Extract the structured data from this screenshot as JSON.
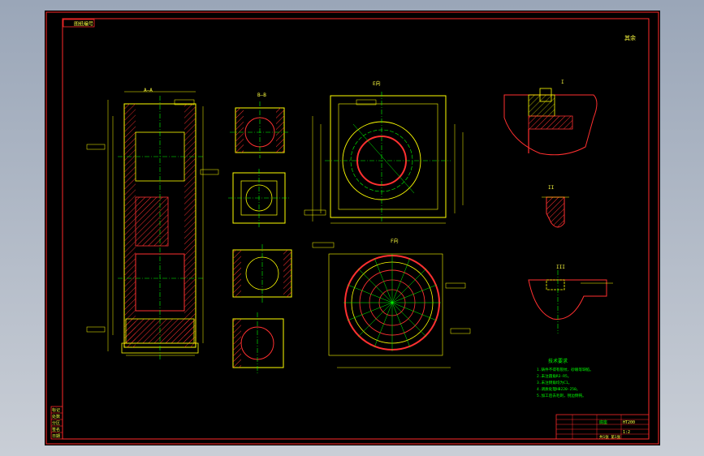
{
  "title_tag": "图纸编号",
  "corner_note": "其余",
  "views": [
    {
      "name": "section-A-A",
      "label": "A—A"
    },
    {
      "name": "section-B-B",
      "label": "B—B"
    },
    {
      "name": "view-E",
      "label": "E向"
    },
    {
      "name": "view-F",
      "label": "F向"
    },
    {
      "name": "detail-I",
      "label": "I"
    },
    {
      "name": "detail-II",
      "label": "II"
    },
    {
      "name": "detail-III",
      "label": "III"
    }
  ],
  "tech_requirements": {
    "heading": "技术要求",
    "lines": [
      "1.铸件不得有裂纹、砂眼等缺陷。",
      "2.未注圆角R3-R5。",
      "3.未注倒角均为C1。",
      "4.调质处理HB220-250。",
      "5.加工后去毛刺，锐边倒钝。"
    ]
  },
  "title_block": {
    "part_name": "底座",
    "material": "HT200",
    "scale": "1:2",
    "sheet": "共1张 第1张"
  },
  "left_strip": [
    "标记",
    "处数",
    "分区",
    "签名",
    "日期"
  ],
  "colors": {
    "background": "#000000",
    "frame": "#ff2a2a",
    "outline": "#ffff00",
    "centerline": "#00ff00",
    "hatch": "#ff3030",
    "text": "#ffff40"
  }
}
